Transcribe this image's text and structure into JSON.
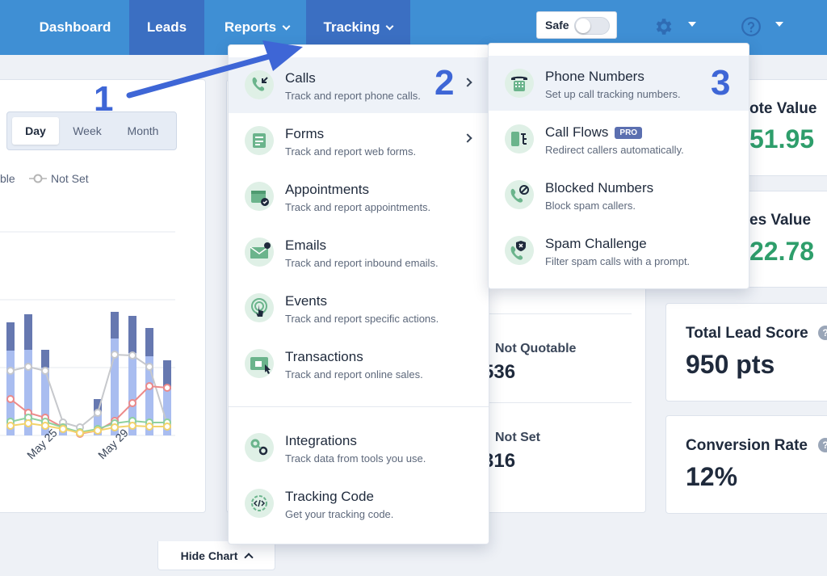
{
  "nav": {
    "dashboard": "Dashboard",
    "leads": "Leads",
    "reports": "Reports",
    "tracking": "Tracking",
    "safe_label": "Safe",
    "safe_toggle_on": false
  },
  "chart": {
    "ranges": [
      "Day",
      "Week",
      "Month"
    ],
    "active_range": "Day",
    "legend_partial": "ble",
    "legend_not_set": "Not Set",
    "x_ticks": [
      "May 25",
      "May 29"
    ]
  },
  "stats": {
    "quote_value_label": "ote Value",
    "quote_value": "51.95",
    "sales_value_label": "es Value",
    "sales_value": "22.78",
    "lead_score_label": "Total Lead Score",
    "lead_score": "950 pts",
    "conversion_label": "Conversion Rate",
    "conversion": "12%",
    "not_quotable_label": "Not Quotable",
    "not_quotable_value": "536",
    "not_set_label": "Not Set",
    "not_set_value": "316",
    "help_glyph": "?"
  },
  "tracking_menu": [
    {
      "title": "Calls",
      "desc": "Track and report phone calls.",
      "icon": "phone-icon",
      "submenu": true
    },
    {
      "title": "Forms",
      "desc": "Track and report web forms.",
      "icon": "form-icon",
      "submenu": true
    },
    {
      "title": "Appointments",
      "desc": "Track and report appointments.",
      "icon": "calendar-icon",
      "submenu": false
    },
    {
      "title": "Emails",
      "desc": "Track and report inbound emails.",
      "icon": "email-icon",
      "submenu": false
    },
    {
      "title": "Events",
      "desc": "Track and report specific actions.",
      "icon": "touch-icon",
      "submenu": false
    },
    {
      "title": "Transactions",
      "desc": "Track and report online sales.",
      "icon": "cart-icon",
      "submenu": false
    },
    {
      "title": "Integrations",
      "desc": "Track data from tools you use.",
      "icon": "integrations-icon",
      "submenu": false
    },
    {
      "title": "Tracking Code",
      "desc": "Get your tracking code.",
      "icon": "code-icon",
      "submenu": false
    }
  ],
  "calls_submenu": [
    {
      "title": "Phone Numbers",
      "desc": "Set up call tracking numbers.",
      "icon": "desk-phone-icon"
    },
    {
      "title": "Call Flows",
      "desc": "Redirect callers automatically.",
      "icon": "call-flow-icon",
      "badge": "PRO"
    },
    {
      "title": "Blocked Numbers",
      "desc": "Block spam callers.",
      "icon": "blocked-phone-icon"
    },
    {
      "title": "Spam Challenge",
      "desc": "Filter spam calls with a prompt.",
      "icon": "shield-phone-icon"
    }
  ],
  "steps": [
    "1",
    "2",
    "3"
  ],
  "hide_chart": "Hide Chart",
  "colors": {
    "topbar": "#3f8fd4",
    "nav_active": "#3b6fc2",
    "accent_green": "#2e9e6b",
    "step_blue": "#3e66d6"
  }
}
